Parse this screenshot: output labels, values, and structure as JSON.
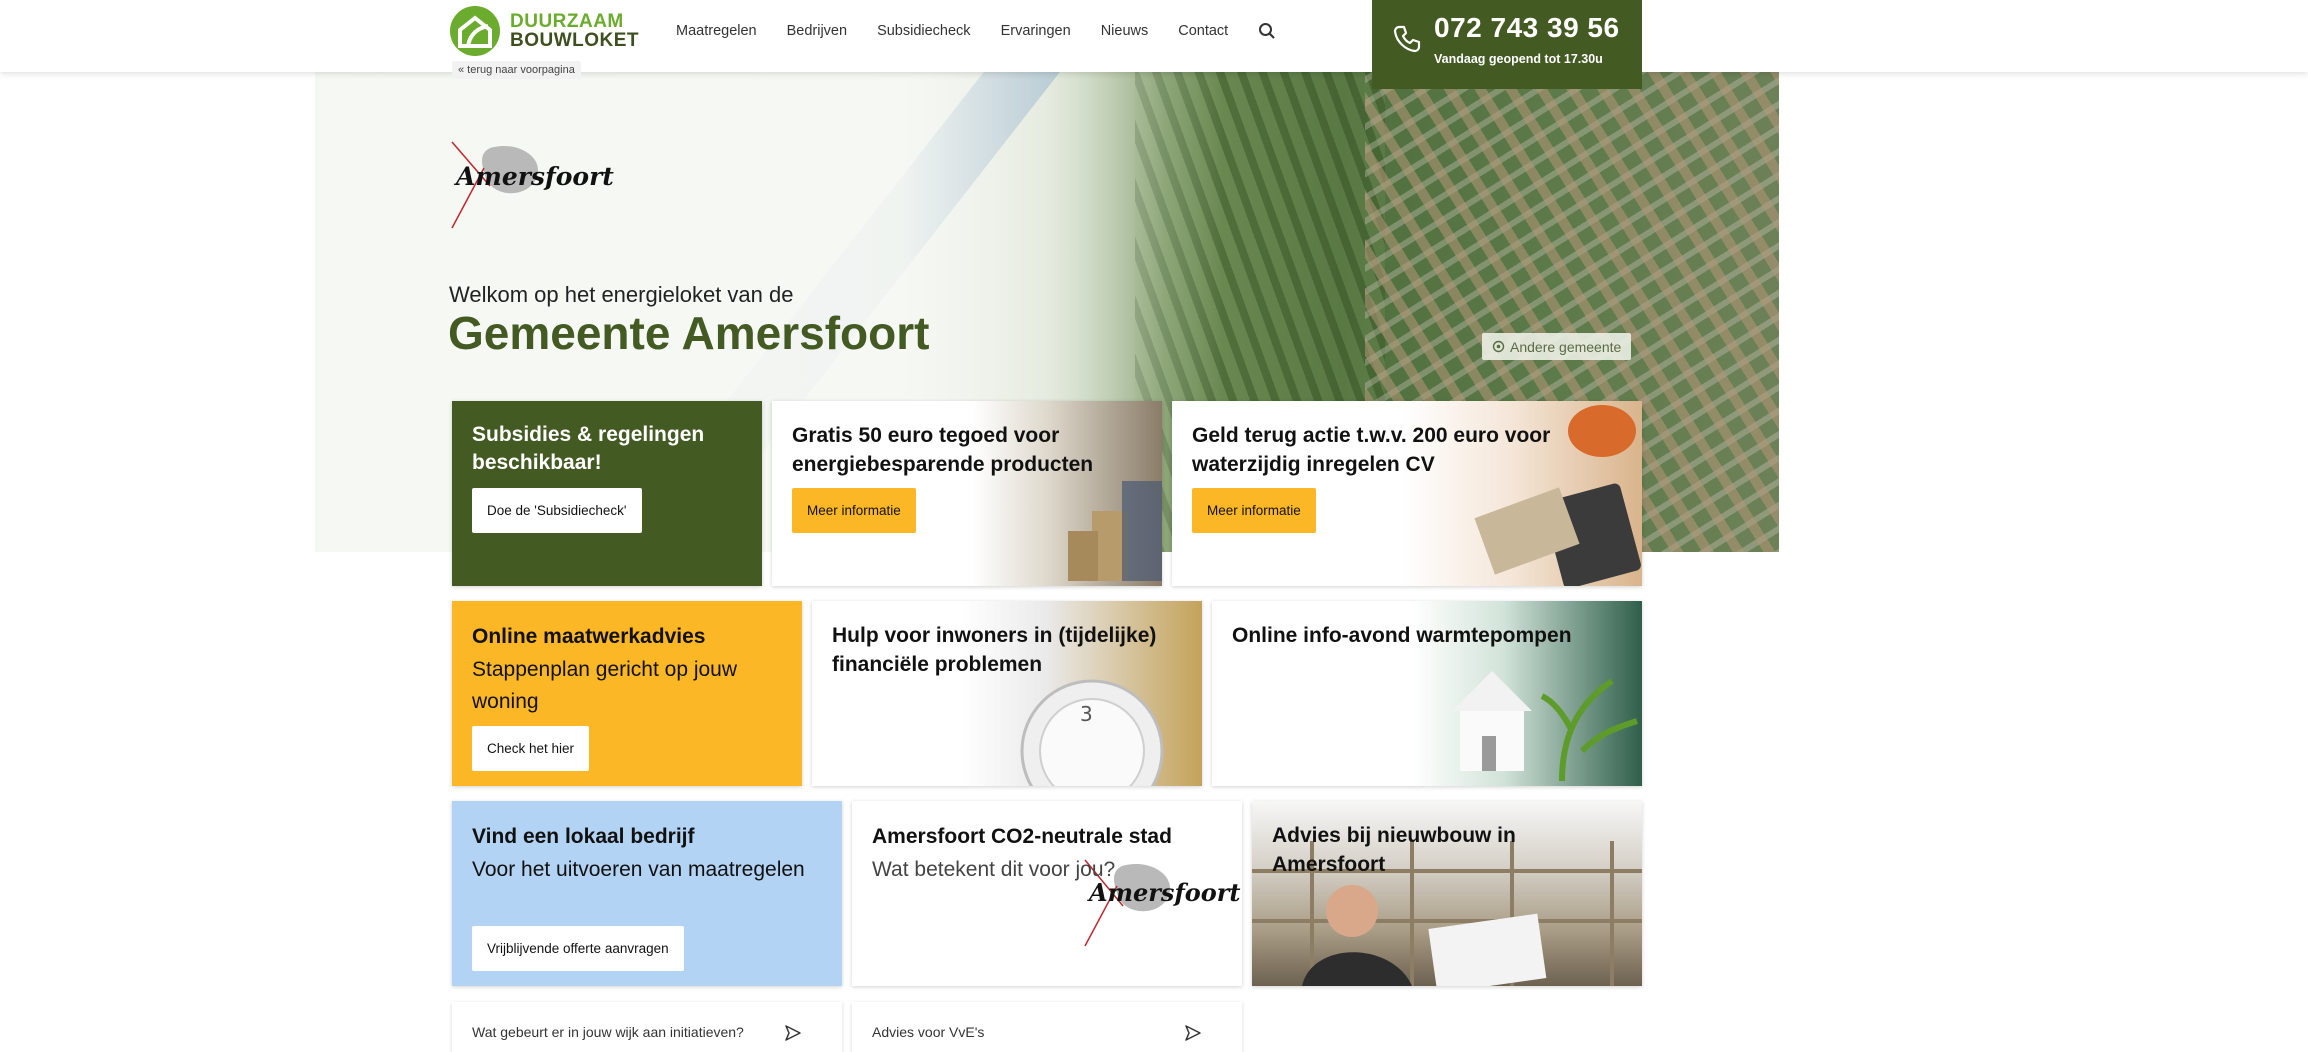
{
  "brand": {
    "line1": "DUURZAAM",
    "line2": "BOUWLOKET",
    "accent": "#6bab2d",
    "dark_green": "#435a22"
  },
  "nav": {
    "items": [
      "Maatregelen",
      "Bedrijven",
      "Subsidiecheck",
      "Ervaringen",
      "Nieuws",
      "Contact"
    ],
    "search_icon": "search-icon"
  },
  "phone": {
    "number": "072 743 39 56",
    "hours": "Vandaag geopend tot 17.30u"
  },
  "back_link": "« terug naar voorpagina",
  "hero": {
    "municipality_logo_text": "Amersfoort",
    "welcome": "Welkom op het energieloket van de",
    "title": "Gemeente Amersfoort",
    "other_municipality": "Andere gemeente"
  },
  "cards": [
    {
      "title": "Subsidies & regelingen beschikbaar!",
      "button": "Doe de 'Subsidiecheck'"
    },
    {
      "title": "Gratis 50 euro tegoed voor energiebesparende producten",
      "button": "Meer informatie"
    },
    {
      "title": "Geld terug actie t.w.v. 200 euro voor waterzijdig inregelen CV",
      "button": "Meer informatie"
    },
    {
      "title": "Online maatwerkadvies",
      "subtitle": "Stappenplan gericht op jouw woning",
      "button": "Check het hier"
    },
    {
      "title": "Hulp voor inwoners in (tijdelijke) financiële problemen"
    },
    {
      "title": "Online info-avond warmtepompen"
    },
    {
      "title": "Vind een lokaal bedrijf",
      "subtitle": "Voor het uitvoeren van maatregelen",
      "button": "Vrijblijvende offerte aanvragen"
    },
    {
      "title": "Amersfoort CO2-neutrale stad",
      "subtitle": "Wat betekent dit voor jou?",
      "logo_text": "Amersfoort"
    },
    {
      "title": "Advies bij nieuwbouw in Amersfoort"
    }
  ],
  "links": [
    {
      "label": "Wat gebeurt er in jouw wijk aan initiatieven?"
    },
    {
      "label": "Advies voor VvE's"
    }
  ],
  "colors": {
    "yellow": "#fbb726",
    "blue": "#b3d3f4",
    "green": "#435a22"
  }
}
